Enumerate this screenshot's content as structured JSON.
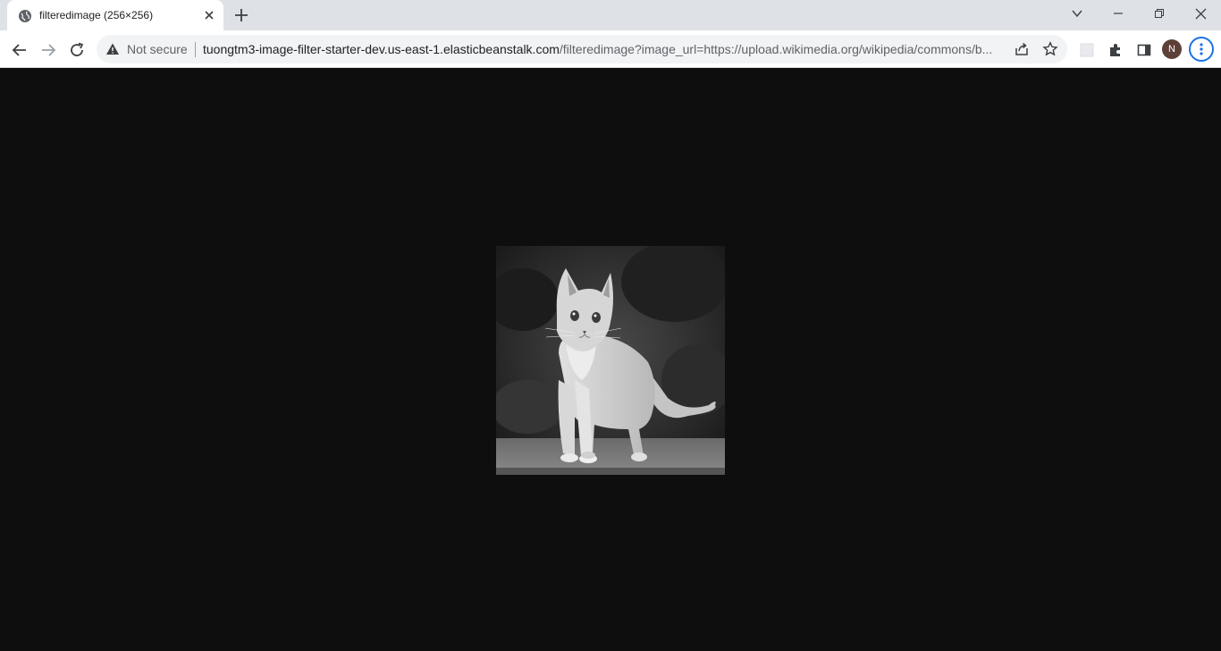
{
  "tab": {
    "title": "filteredimage (256×256)",
    "favicon": "globe-icon"
  },
  "window_controls": [
    "chevron-down-icon",
    "minimize-icon",
    "restore-icon",
    "close-icon"
  ],
  "toolbar": {
    "security_label": "Not secure",
    "url_host": "tuongtm3-image-filter-starter-dev.us-east-1.elasticbeanstalk.com",
    "url_path": "/filteredimage?image_url=https://upload.wikimedia.org/wikipedia/commons/b...",
    "profile_initial": "N"
  },
  "content": {
    "image_description_name": "grayscale-kitten-image",
    "background": "#0e0e0e"
  },
  "colors": {
    "accent": "#1a73e8",
    "tabstrip": "#dee1e6",
    "avatar": "#5d4037"
  }
}
